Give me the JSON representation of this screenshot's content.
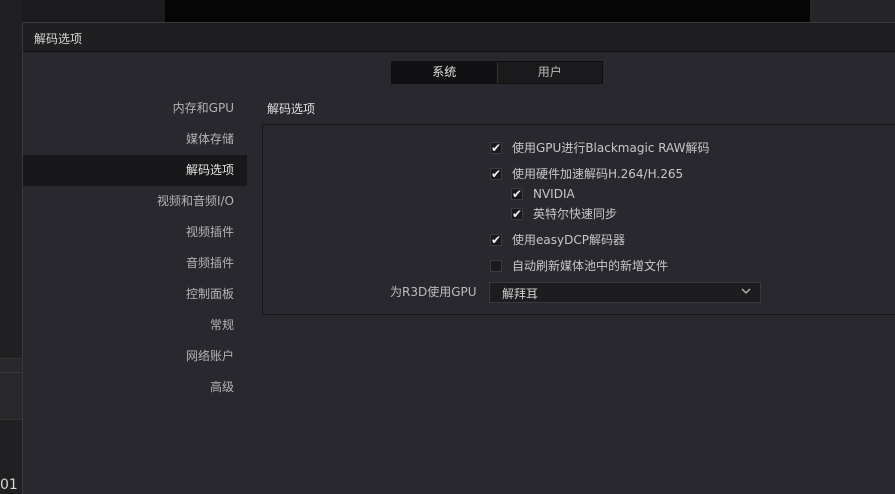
{
  "background": {
    "partial_text": "01"
  },
  "dialog": {
    "title": "解码选项",
    "tabs": [
      {
        "label": "系统",
        "active": true
      },
      {
        "label": "用户",
        "active": false
      }
    ],
    "sidebar": {
      "items": [
        {
          "label": "内存和GPU"
        },
        {
          "label": "媒体存储"
        },
        {
          "label": "解码选项",
          "active": true
        },
        {
          "label": "视频和音频I/O"
        },
        {
          "label": "视频插件"
        },
        {
          "label": "音频插件"
        },
        {
          "label": "控制面板"
        },
        {
          "label": "常规"
        },
        {
          "label": "网络账户"
        },
        {
          "label": "高级"
        }
      ]
    },
    "section_title": "解码选项",
    "options": [
      {
        "label": "使用GPU进行Blackmagic RAW解码",
        "checked": true,
        "check_glyph": "✔"
      },
      {
        "label": "使用硬件加速解码H.264/H.265",
        "checked": true,
        "check_glyph": "✔"
      },
      {
        "label": "NVIDIA",
        "checked": true,
        "check_glyph": "✔"
      },
      {
        "label": "英特尔快速同步",
        "checked": true,
        "check_glyph": "✔"
      },
      {
        "label": "使用easyDCP解码器",
        "checked": true,
        "check_glyph": "✔"
      },
      {
        "label": "自动刷新媒体池中的新增文件",
        "checked": false,
        "check_glyph": ""
      }
    ],
    "r3d_gpu": {
      "label": "为R3D使用GPU",
      "value": "解拜耳",
      "icon": "chevron-down-icon"
    }
  }
}
